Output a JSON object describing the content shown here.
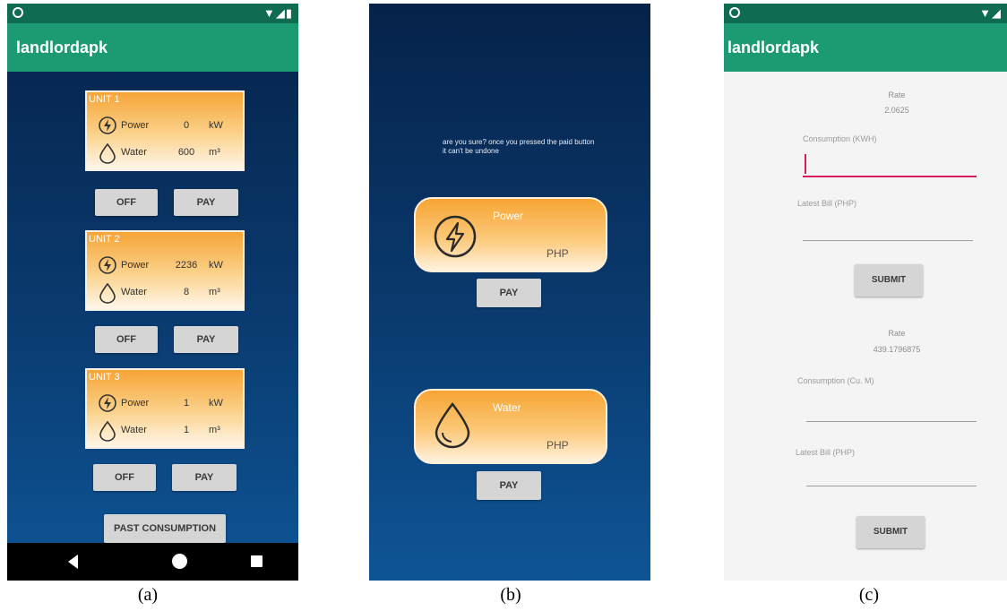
{
  "screen_a": {
    "app_title": "landlordapk",
    "units": [
      {
        "title": "UNIT 1",
        "power_label": "Power",
        "power_value": "0",
        "power_unit": "kW",
        "water_label": "Water",
        "water_value": "600",
        "water_unit": "m³",
        "off_label": "OFF",
        "pay_label": "PAY"
      },
      {
        "title": "UNIT 2",
        "power_label": "Power",
        "power_value": "2236",
        "power_unit": "kW",
        "water_label": "Water",
        "water_value": "8",
        "water_unit": "m³",
        "off_label": "OFF",
        "pay_label": "PAY"
      },
      {
        "title": "UNIT 3",
        "power_label": "Power",
        "power_value": "1",
        "power_unit": "kW",
        "water_label": "Water",
        "water_value": "1",
        "water_unit": "m³",
        "off_label": "OFF",
        "pay_label": "PAY"
      }
    ],
    "past_consumption_label": "PAST CONSUMPTION"
  },
  "screen_b": {
    "confirm_text": "are you sure? once you pressed the paid button it can't be undone",
    "power_title": "Power",
    "power_currency": "PHP",
    "water_title": "Water",
    "water_currency": "PHP",
    "pay_label": "PAY"
  },
  "screen_c": {
    "app_title": "landlordapk",
    "power_rate_label": "Rate",
    "power_rate_value": "2.0625",
    "power_consumption_hint": "Consumption (KWH)",
    "power_latest_bill_hint": "Latest Bill (PHP)",
    "submit_label": "SUBMIT",
    "water_rate_label": "Rate",
    "water_rate_value": "439.1796875",
    "water_consumption_hint": "Consumption (Cu. M)",
    "water_latest_bill_hint": "Latest Bill (PHP)"
  },
  "captions": {
    "a": "(a)",
    "b": "(b)",
    "c": "(c)"
  },
  "colors": {
    "app_bar": "#1b9a74",
    "status_bar": "#0f6b51",
    "card_orange": "#f7a534",
    "field_focus": "#d81b60"
  }
}
